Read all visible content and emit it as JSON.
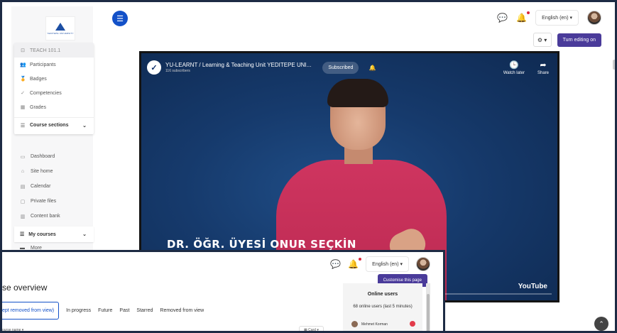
{
  "back_window": {
    "top_bar": {
      "language": "English (en)",
      "language_caret": "▾"
    },
    "sidebar": {
      "logo_text": "YEDITEPE UNIVERSITY",
      "course_menu": [
        {
          "icon": "course-icon",
          "label": "TEACH 101.1"
        },
        {
          "icon": "participants-icon",
          "label": "Participants"
        },
        {
          "icon": "badges-icon",
          "label": "Badges"
        },
        {
          "icon": "check-icon",
          "label": "Competencies"
        },
        {
          "icon": "grades-icon",
          "label": "Grades"
        }
      ],
      "course_sections": "Course sections",
      "nav": [
        {
          "icon": "dashboard-icon",
          "label": "Dashboard"
        },
        {
          "icon": "home-icon",
          "label": "Site home"
        },
        {
          "icon": "calendar-icon",
          "label": "Calendar"
        },
        {
          "icon": "files-icon",
          "label": "Private files"
        },
        {
          "icon": "content-bank-icon",
          "label": "Content bank"
        }
      ],
      "my_courses": "My courses",
      "more": "More"
    },
    "edit_bar": {
      "gear_caret": "▾",
      "turn_editing_on": "Turn editing on"
    },
    "video": {
      "channel_title": "YU-LEARNT / Learning & Teaching Unit YEDITEPE UNI...",
      "subscribers": "116 subscribers",
      "subscribed": "Subscribed",
      "watch_later": "Watch later",
      "share": "Share",
      "caption": "DR. ÖĞR. ÜYESİ ONUR SEÇKİN",
      "brand": "YouTube"
    }
  },
  "front_window": {
    "language": "English (en)",
    "language_caret": "▾",
    "title": "se overview",
    "customise": "Customise this page",
    "tabs": [
      {
        "label": "ept removed from view)",
        "active": true
      },
      {
        "label": "In progress",
        "active": false
      },
      {
        "label": "Future",
        "active": false
      },
      {
        "label": "Past",
        "active": false
      },
      {
        "label": "Starred",
        "active": false
      },
      {
        "label": "Removed from view",
        "active": false
      }
    ],
    "sort_label": "ourse name",
    "sort_caret": "▾",
    "view_select": "Card",
    "view_caret": "▾",
    "online_users": {
      "title": "Online users",
      "subtitle": "68 online users (last 5 minutes)",
      "first_user": "Mehmet Korman"
    }
  }
}
